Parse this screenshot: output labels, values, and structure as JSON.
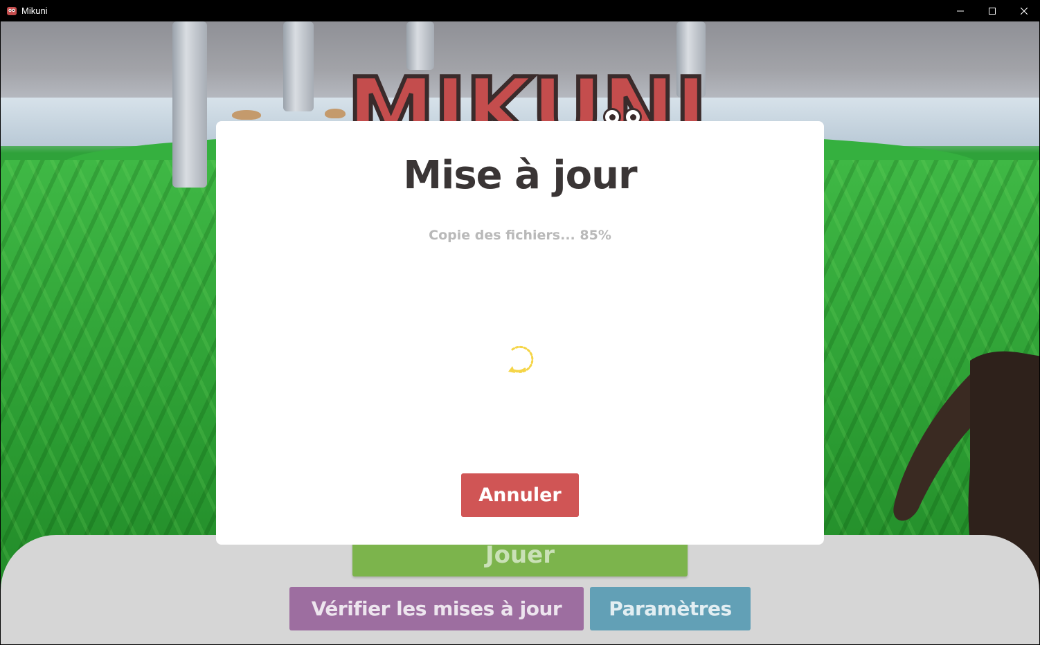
{
  "window": {
    "title": "Mikuni"
  },
  "logo": {
    "text": "MIKUNI"
  },
  "main_menu": {
    "play_label": "Jouer",
    "check_updates_label": "Vérifier les mises à jour",
    "settings_label": "Paramètres"
  },
  "update_dialog": {
    "title": "Mise à jour",
    "status": "Copie des fichiers... 85%",
    "progress_percent": 85,
    "cancel_label": "Annuler"
  },
  "colors": {
    "play": "#7cb44c",
    "check_updates": "#9d6ea0",
    "settings": "#62a0b6",
    "cancel": "#d05555",
    "spinner": "#f5d547",
    "logo": "#c44d4d"
  },
  "icons": {
    "app": "mikuni-app-icon",
    "minimize": "minimize-icon",
    "maximize": "maximize-icon",
    "close": "close-icon",
    "spinner": "loading-spinner-icon"
  }
}
